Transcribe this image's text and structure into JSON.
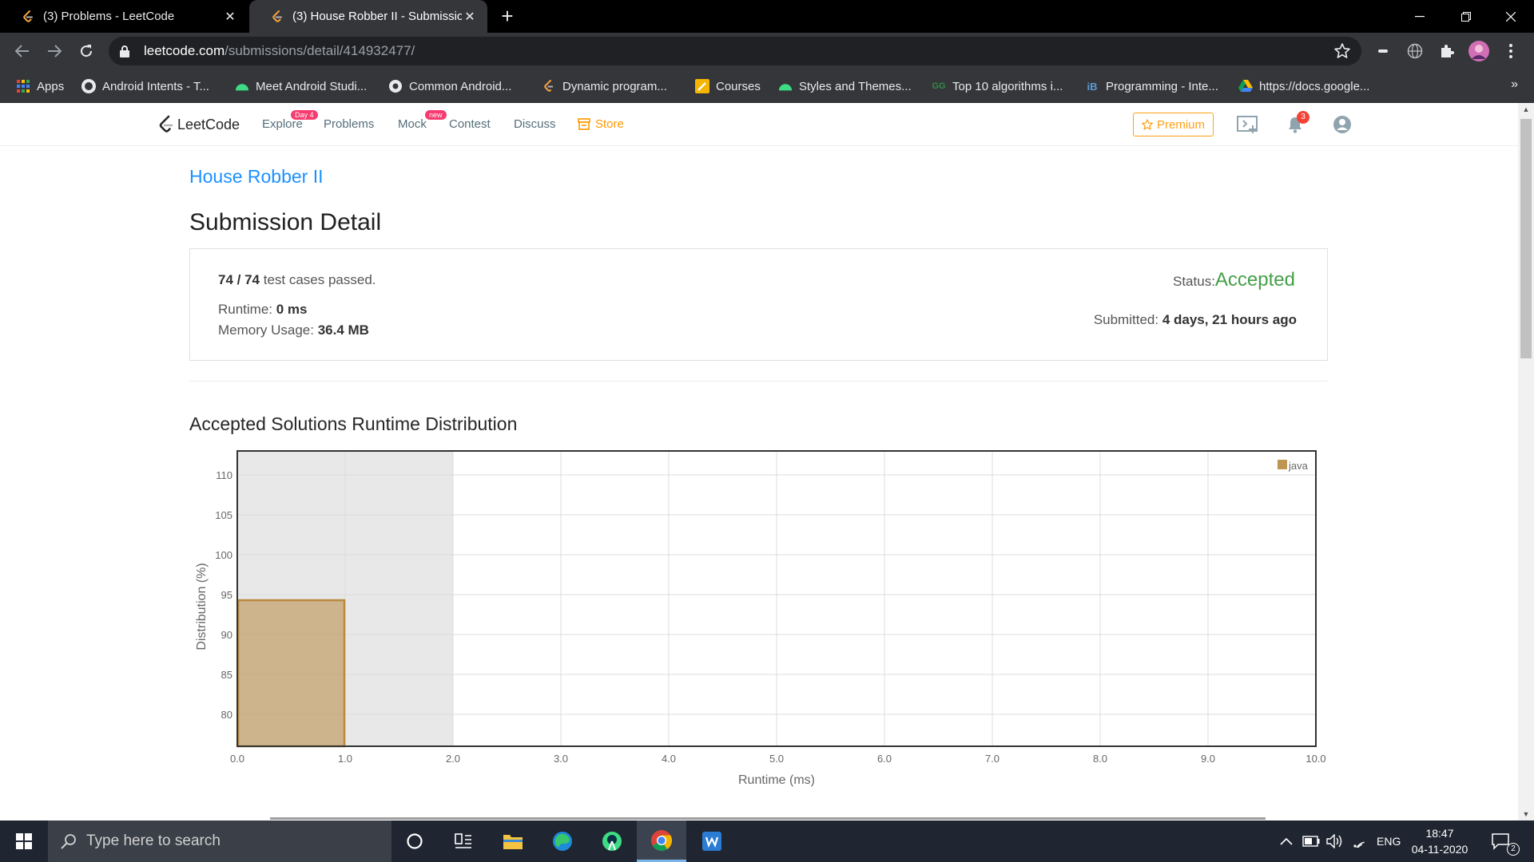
{
  "browser": {
    "tabs": [
      {
        "title": "(3) Problems - LeetCode",
        "active": false
      },
      {
        "title": "(3) House Robber II - Submission",
        "active": true
      }
    ],
    "url_host": "leetcode.com",
    "url_path": "/submissions/detail/414932477/",
    "bookmarks": [
      {
        "label": "Apps",
        "icon": "apps-grid-icon"
      },
      {
        "label": "Android Intents - T...",
        "icon": "github-icon"
      },
      {
        "label": "Meet Android Studi...",
        "icon": "android-icon"
      },
      {
        "label": "Common Android...",
        "icon": "chrome-icon"
      },
      {
        "label": "Dynamic program...",
        "icon": "leetcode-icon"
      },
      {
        "label": "Courses",
        "icon": "pencil-icon"
      },
      {
        "label": "Styles and Themes...",
        "icon": "android-icon"
      },
      {
        "label": "Top 10 algorithms i...",
        "icon": "gfg-icon"
      },
      {
        "label": "Programming - Inte...",
        "icon": "ib-icon"
      },
      {
        "label": "https://docs.google...",
        "icon": "drive-icon"
      }
    ],
    "more_bookmarks": "»"
  },
  "nav": {
    "logo": "LeetCode",
    "explore": "Explore",
    "explore_badge": "Day 4",
    "problems": "Problems",
    "mock": "Mock",
    "mock_badge": "new",
    "contest": "Contest",
    "discuss": "Discuss",
    "store": "Store",
    "premium": "Premium",
    "notification_count": "3",
    "accent_color": "#ffa116"
  },
  "submission": {
    "problem_title": "House Robber II",
    "page_title": "Submission Detail",
    "cases_passed": "74 / 74",
    "cases_suffix": " test cases passed.",
    "runtime_label": "Runtime: ",
    "runtime_value": "0 ms",
    "memory_label": "Memory Usage: ",
    "memory_value": "36.4 MB",
    "status_label": "Status: ",
    "status_value": "Accepted",
    "submitted_label": "Submitted: ",
    "submitted_value": "4 days, 21 hours ago"
  },
  "distribution_title": "Accepted Solutions Runtime Distribution",
  "chart_data": {
    "type": "bar",
    "xlabel": "Runtime (ms)",
    "ylabel": "Distribution (%)",
    "xlim": [
      0,
      10
    ],
    "ylim": [
      76,
      113
    ],
    "x_ticks": [
      "0.0",
      "1.0",
      "2.0",
      "3.0",
      "4.0",
      "5.0",
      "6.0",
      "7.0",
      "8.0",
      "9.0",
      "10.0"
    ],
    "y_ticks": [
      80,
      85,
      90,
      95,
      100,
      105,
      110
    ],
    "highlight_range": [
      0,
      2
    ],
    "legend_position": "top-right",
    "grid": true,
    "series": [
      {
        "name": "java",
        "color": "#b8893f",
        "bars": [
          {
            "x_start": 0,
            "x_end": 1,
            "value": 94.3
          }
        ]
      }
    ]
  },
  "taskbar": {
    "search_placeholder": "Type here to search",
    "language": "ENG",
    "time": "18:47",
    "date": "04-11-2020",
    "notification_count": "2"
  }
}
